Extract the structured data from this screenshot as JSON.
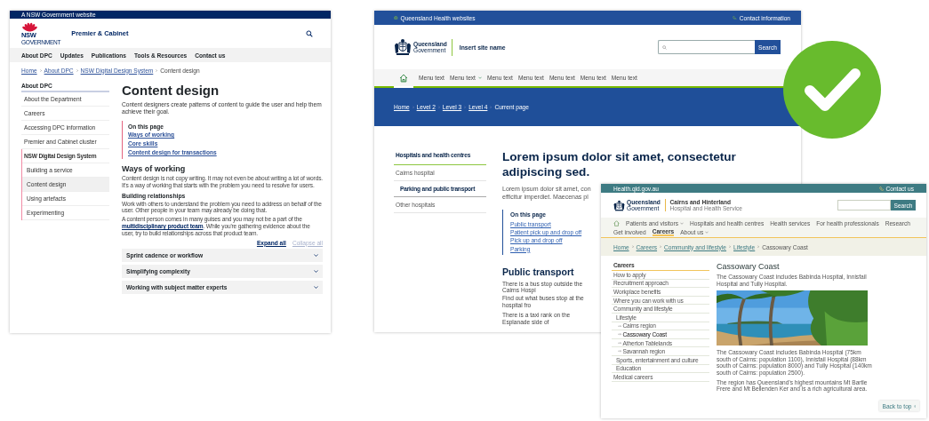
{
  "nsw_page": {
    "top_bar": "A NSW Government website",
    "logo": {
      "wordmark": "NSW",
      "subtext": "GOVERNMENT"
    },
    "site_title": "Premier & Cabinet",
    "nav": [
      "About DPC",
      "Updates",
      "Publications",
      "Tools & Resources",
      "Contact us"
    ],
    "breadcrumbs": [
      "Home",
      "About DPC",
      "NSW Digital Design System",
      "Content design"
    ],
    "sidebar": {
      "heading": "About DPC",
      "items": [
        {
          "label": "About the Department",
          "selected": false
        },
        {
          "label": "Careers",
          "selected": false
        },
        {
          "label": "Accessing DPC information",
          "selected": false
        },
        {
          "label": "Premier and Cabinet cluster",
          "selected": false
        },
        {
          "label": "NSW Digital Design System",
          "selected": false,
          "children": [
            {
              "label": "Building a service",
              "selected": false
            },
            {
              "label": "Content design",
              "selected": true
            },
            {
              "label": "Using artefacts",
              "selected": false
            },
            {
              "label": "Experimenting",
              "selected": false
            }
          ]
        }
      ]
    },
    "title": "Content design",
    "lead": "Content designers create patterns of content to guide the user and help them achieve their goal.",
    "on_this_page": {
      "heading": "On this page",
      "links": [
        "Ways of working",
        "Core skills",
        "Content design for transactions"
      ]
    },
    "section_heading": "Ways of working",
    "section_text": "Content design is not copy writing. It may not even be about writing a lot of words. It's a way of working that starts with the problem you need to resolve for users.",
    "subheading": "Building relationships",
    "subsection_text": "Work with others to understand the problem you need to address on behalf of the user. Other people in your team may already be doing that.",
    "linked_paragraph": {
      "before": "A content person comes in many guises and you may not be a part of the ",
      "link": "multidisciplinary product team",
      "after": ". While you're gathering evidence about the user, try to build relationships across that product team."
    },
    "accordion_controls": [
      {
        "label": "Expand all",
        "disabled": false
      },
      {
        "label": "Collapse all",
        "disabled": true
      }
    ],
    "accordions": [
      {
        "title": "Sprint cadence or workflow",
        "expanded": false
      },
      {
        "title": "Simplifying complexity",
        "expanded": false
      },
      {
        "title": "Working with subject matter experts",
        "expanded": false
      }
    ]
  },
  "qld_health_page": {
    "top_bar": {
      "left": "Queensland Health websites",
      "right": "Contact information"
    },
    "logo": {
      "line_1": "Queensland",
      "line_2": "Government"
    },
    "site_name": "Insert site name",
    "search_button": "Search",
    "menu": [
      {
        "label": "Menu text",
        "has_dropdown": false
      },
      {
        "label": "Menu text",
        "has_dropdown": true
      },
      {
        "label": "Menu text",
        "has_dropdown": false
      },
      {
        "label": "Menu text",
        "has_dropdown": false
      },
      {
        "label": "Menu text",
        "has_dropdown": false
      },
      {
        "label": "Menu text",
        "has_dropdown": false
      },
      {
        "label": "Menu text",
        "has_dropdown": false
      }
    ],
    "breadcrumbs": [
      "Home",
      "Level 2",
      "Level 3",
      "Level 4",
      "Current page"
    ],
    "sidebar": {
      "heading": "Hospitals and health centres",
      "items": [
        {
          "label": "Cairns hospital",
          "selected": false,
          "children": [
            {
              "label": "Parking and public transport",
              "selected": true
            }
          ]
        },
        {
          "label": "Other hospitals",
          "selected": false
        }
      ]
    },
    "title": "Lorem ipsum dolor sit amet, consectetur adipiscing sed.",
    "lead_lines": [
      "Lorem ipsum dolor sit amet, con",
      "efficitur imperdiet. Maecenas pl"
    ],
    "on_this_page": {
      "heading": "On this page",
      "links": [
        "Public transport",
        "Patient pick up and drop off",
        "Pick up and drop off",
        "Parking"
      ]
    },
    "section_heading": "Public transport",
    "paragraphs": [
      [
        "There is a bus stop outside the Cairns Hospi",
        "Find out what buses stop at the hospital fro"
      ],
      [
        "There is a taxi rank on the Esplanade side of"
      ]
    ]
  },
  "cairns_page": {
    "top_bar": {
      "left": "Health.qld.gov.au",
      "right": "Contact us"
    },
    "logo": {
      "line_1": "Queensland",
      "line_2": "Government"
    },
    "site_name": "Cairns and Hinterland",
    "site_subtitle": "Hospital and Health Service",
    "search_button": "Search",
    "menu": [
      {
        "label": "Patients and visitors",
        "has_dropdown": true,
        "selected": false
      },
      {
        "label": "Hospitals and health centres",
        "has_dropdown": false,
        "selected": false
      },
      {
        "label": "Health services",
        "has_dropdown": false,
        "selected": false
      },
      {
        "label": "For health professionals",
        "has_dropdown": false,
        "selected": false
      },
      {
        "label": "Research",
        "has_dropdown": false,
        "selected": false
      },
      {
        "label": "Get involved",
        "has_dropdown": false,
        "selected": false
      },
      {
        "label": "Careers",
        "has_dropdown": false,
        "selected": true
      },
      {
        "label": "About us",
        "has_dropdown": true,
        "selected": false
      }
    ],
    "breadcrumbs": [
      "Home",
      "Careers",
      "Community and lifestyle",
      "Lifestyle",
      "Cassowary Coast"
    ],
    "sidebar": {
      "heading": "Careers",
      "items": [
        {
          "label": "How to apply",
          "selected": false
        },
        {
          "label": "Recruitment approach",
          "selected": false
        },
        {
          "label": "Workplace benefits",
          "selected": false
        },
        {
          "label": "Where you can work with us",
          "selected": false
        },
        {
          "label": "Community and lifestyle",
          "selected": false,
          "children": [
            {
              "label": "Lifestyle",
              "selected": false,
              "children": [
                {
                  "label": "Cairns region",
                  "selected": false
                },
                {
                  "label": "Cassowary Coast",
                  "selected": true
                },
                {
                  "label": "Atherton Tablelands",
                  "selected": false
                },
                {
                  "label": "Savannah region",
                  "selected": false
                }
              ]
            },
            {
              "label": "Sports, entertainment and culture",
              "selected": false
            },
            {
              "label": "Education",
              "selected": false
            }
          ]
        },
        {
          "label": "Medical careers",
          "selected": false
        }
      ]
    },
    "title": "Cassowary Coast",
    "intro": "The Cassowary Coast includes Babinda Hospital, Innisfail Hospital and Tully Hospital.",
    "photo": {
      "kind": "picture"
    },
    "paragraphs": [
      "The Cassowary Coast includes Babinda Hospital (75km south of Cairns: population 1100), Innisfail Hospital (88km south of Cairns: population 8000) and Tully Hospital (140km south of Cairns: population 2500).",
      "The region has Queensland's highest mountains Mt Bartle Frere and Mt Bellenden Ker and is a rich agricultural area."
    ],
    "back_to_top": "Back to top"
  }
}
